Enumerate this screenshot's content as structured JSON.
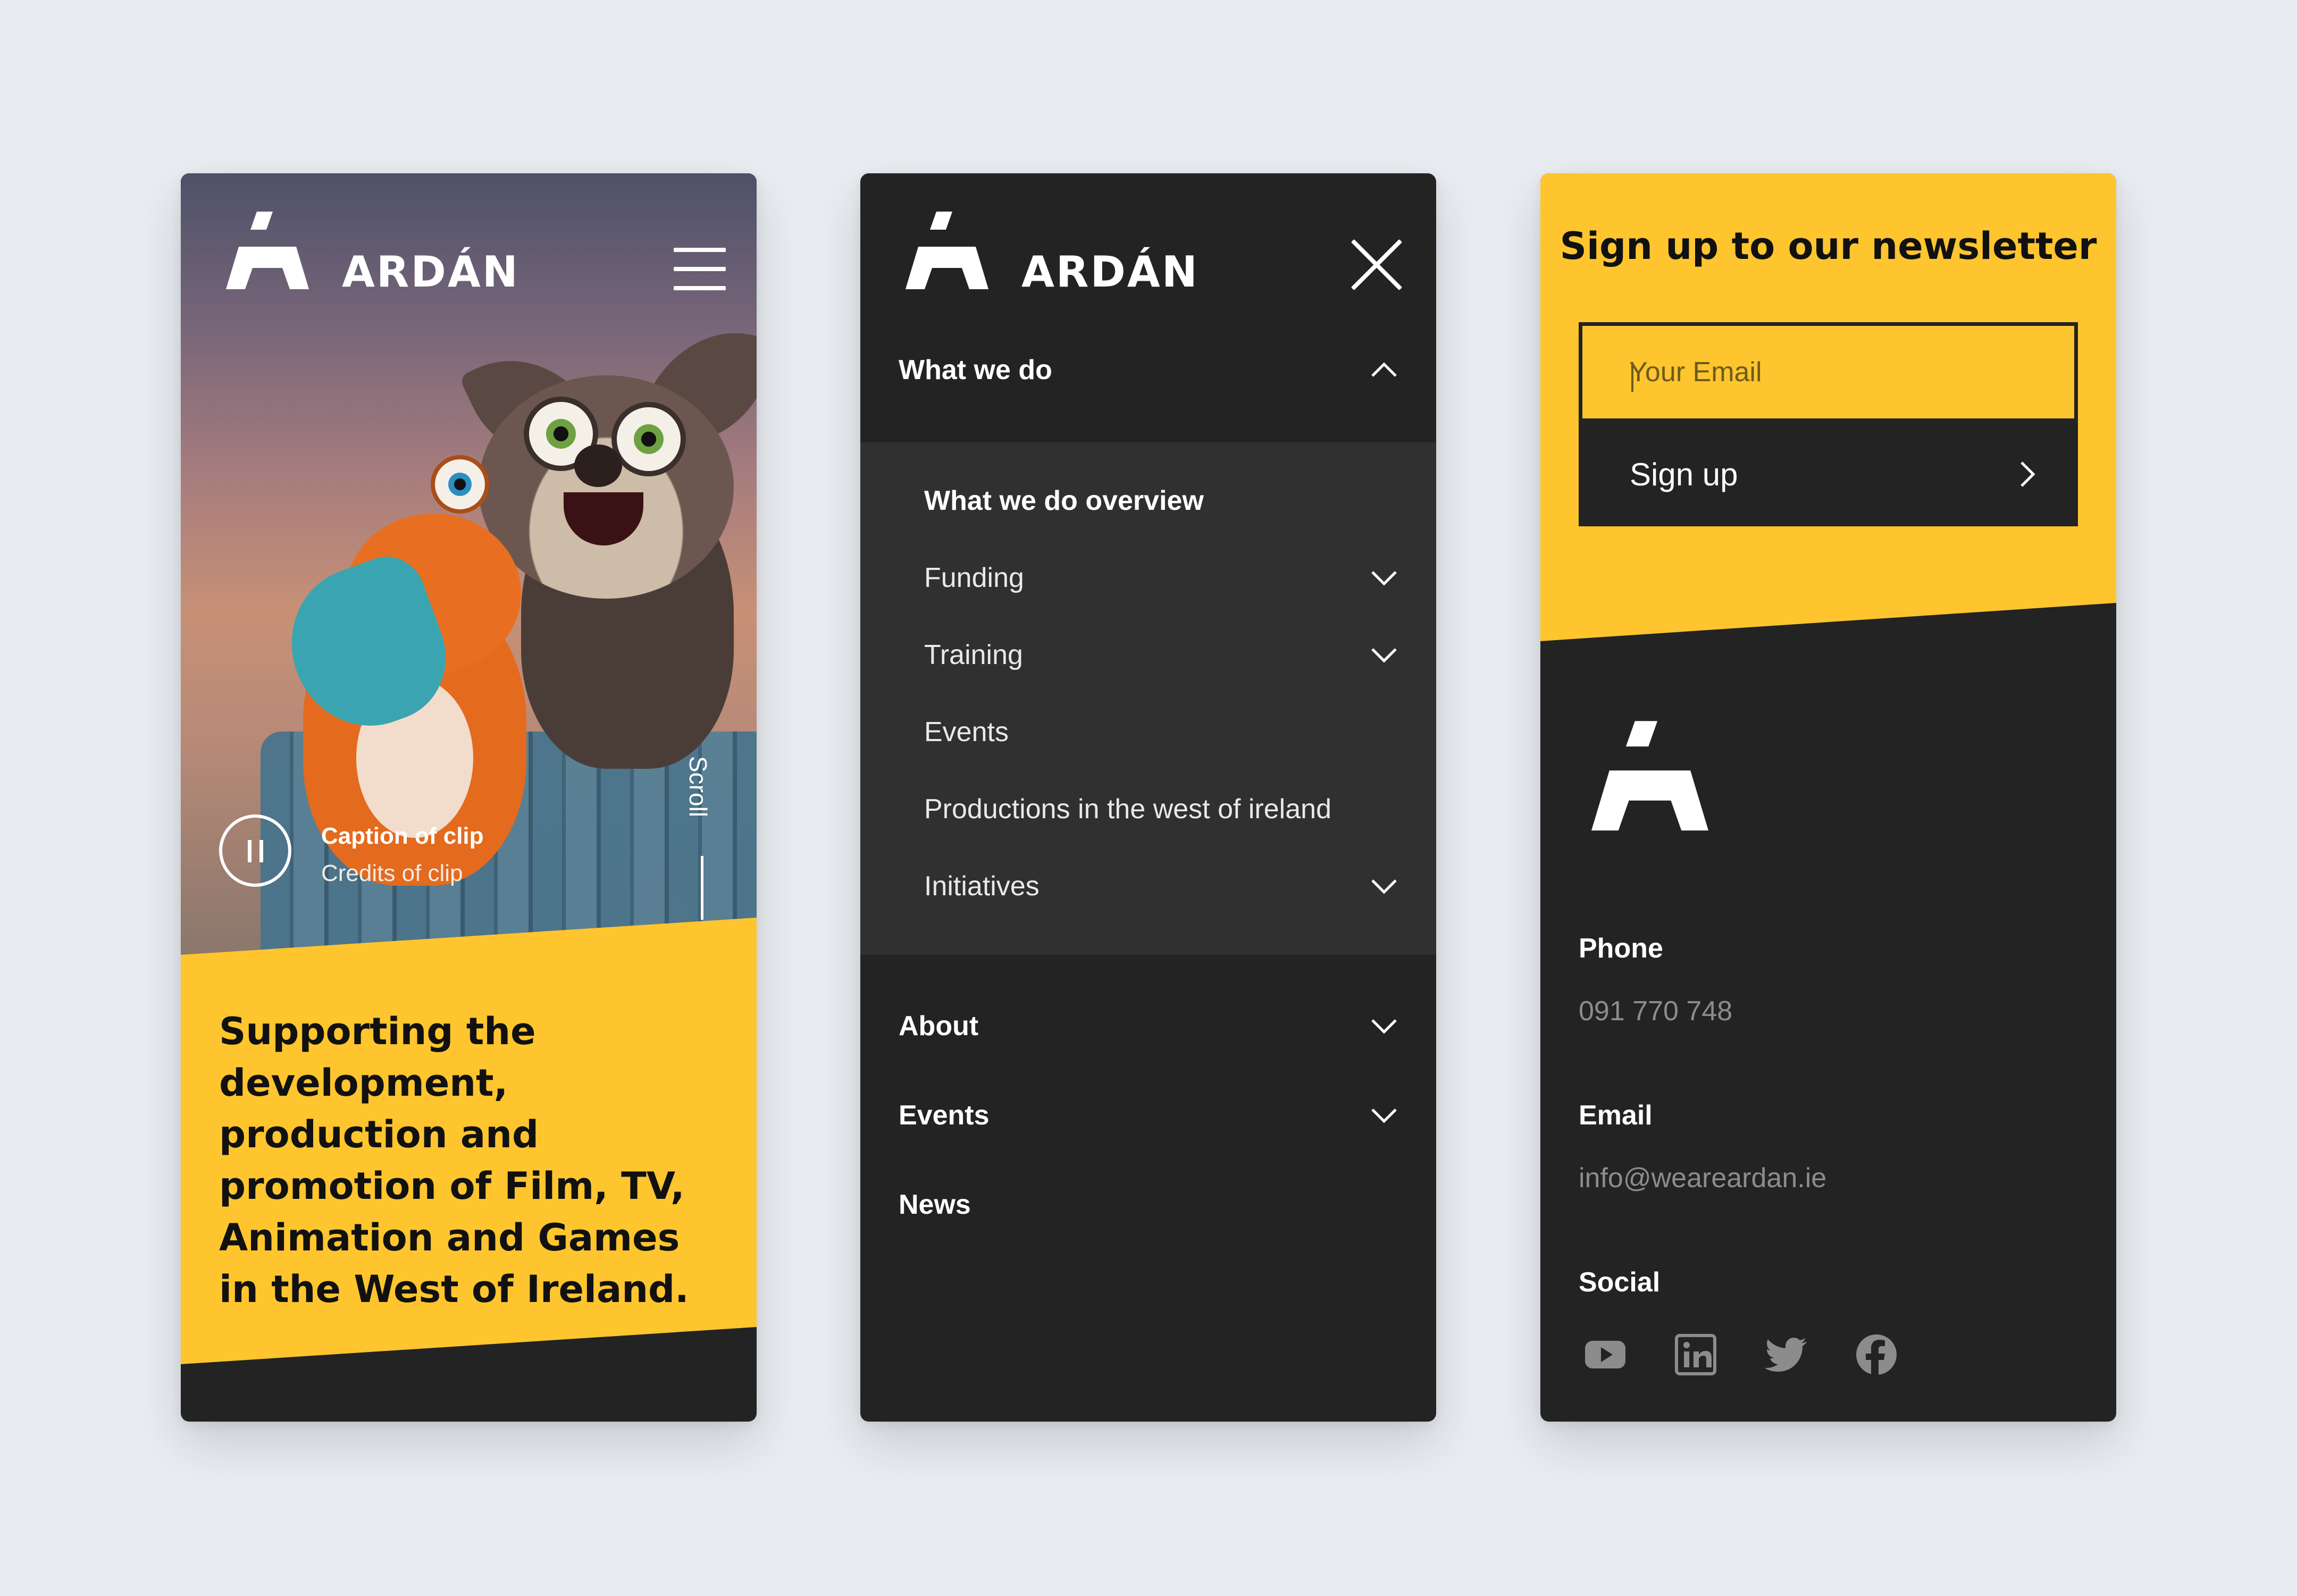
{
  "colors": {
    "accent": "#fec52e",
    "dark": "#232323",
    "submenu": "#303030",
    "background": "#e9ecf0"
  },
  "brand": {
    "name": "ARDÁN"
  },
  "home": {
    "caption_title": "Caption of clip",
    "caption_credits": "Credits of clip",
    "scroll_label": "Scroll",
    "headline": "Supporting the development, production and promotion of Film, TV, Animation and Games in the West of Ireland.",
    "icons": {
      "menu": "hamburger-icon",
      "pause": "pause-icon"
    }
  },
  "menu": {
    "open_section": "What we do",
    "submenu": [
      {
        "label": "What we do overview",
        "expandable": false
      },
      {
        "label": "Funding",
        "expandable": true
      },
      {
        "label": "Training",
        "expandable": true
      },
      {
        "label": "Events",
        "expandable": false
      },
      {
        "label": "Productions in the west of ireland",
        "expandable": false
      },
      {
        "label": "Initiatives",
        "expandable": true
      }
    ],
    "main_items": [
      {
        "label": "About",
        "expandable": true
      },
      {
        "label": "Events",
        "expandable": true
      },
      {
        "label": "News",
        "expandable": false
      }
    ],
    "icons": {
      "close": "close-icon",
      "expand": "chevron-down-icon",
      "collapse": "chevron-up-icon"
    }
  },
  "newsletter": {
    "title": "Sign up to our newsletter",
    "email_placeholder": "Your Email",
    "button_label": "Sign up"
  },
  "footer": {
    "phone_label": "Phone",
    "phone_value": "091 770 748",
    "email_label": "Email",
    "email_value": "info@weareardan.ie",
    "social_label": "Social",
    "social_icons": [
      "youtube-icon",
      "linkedin-icon",
      "twitter-icon",
      "facebook-icon"
    ]
  }
}
